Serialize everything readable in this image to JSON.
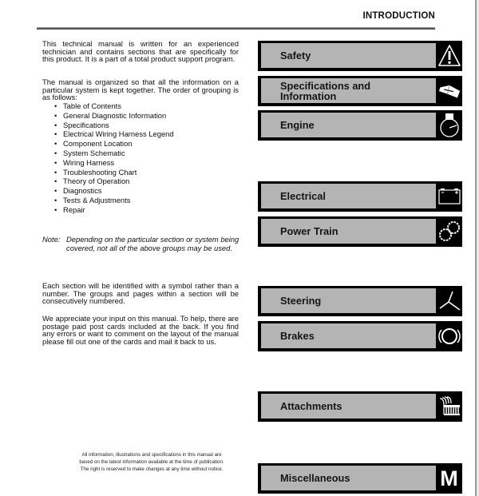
{
  "header": {
    "title": "INTRODUCTION"
  },
  "intro": {
    "paragraph_1": "This technical manual is written for an experienced technician and contains sections that are specifically for this product. It is a part of a total product support program.",
    "paragraph_2": "The manual is organized so that all the information on a particular system is kept together. The order of grouping is as follows:",
    "grouping_list": [
      "Table of Contents",
      "General Diagnostic Information",
      "Specifications",
      "Electrical Wiring Harness Legend",
      "Component Location",
      "System Schematic",
      "Wiring Harness",
      "Troubleshooting Chart",
      "Theory of Operation",
      "Diagnostics",
      "Tests & Adjustments",
      "Repair"
    ],
    "note_label": "Note:",
    "note_text": "Depending on the particular section or system being covered, not all of the above groups may be used.",
    "paragraph_3": "Each section will be identified with a symbol rather than a number. The groups and pages within a section will be consecutively numbered.",
    "paragraph_4": "We appreciate your input on this manual. To help, there are postage paid post cards included at the back. If you find any errors or want to comment on the layout of the manual please fill out one of the cards and mail it back to us.",
    "footer_notice": "All information, illustrations and specifications in this manual are based on the latest information available at the time of publication. The right is reserved to make changes at any time without notice."
  },
  "sections": [
    {
      "label": "Safety",
      "icon": "warning-triangle-icon"
    },
    {
      "label": "Specifications and Information",
      "icon": "open-book-icon"
    },
    {
      "label": "Engine",
      "icon": "stopwatch-icon"
    },
    {
      "label": "Electrical",
      "icon": "battery-icon"
    },
    {
      "label": "Power Train",
      "icon": "gears-icon"
    },
    {
      "label": "Steering",
      "icon": "steering-wheel-icon"
    },
    {
      "label": "Brakes",
      "icon": "brake-drum-icon"
    },
    {
      "label": "Attachments",
      "icon": "attachment-rake-icon"
    },
    {
      "label": "Miscellaneous",
      "icon": "letter-m-icon",
      "icon_text": "M"
    }
  ],
  "colors": {
    "tab_black": "#000000",
    "tab_gray": "#b4b4b4"
  }
}
